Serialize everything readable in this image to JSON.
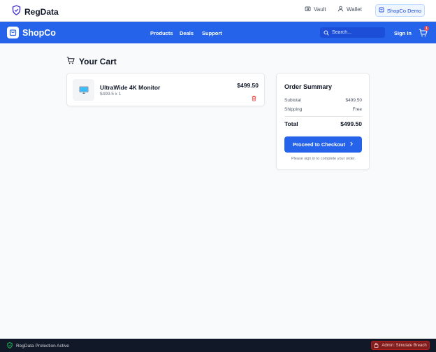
{
  "regdata": {
    "brand": "RegData",
    "nav": {
      "vault": "Vault",
      "wallet": "Wallet",
      "demo": "ShopCo Demo"
    }
  },
  "shop": {
    "brand": "ShopCo",
    "links": [
      "Products",
      "Deals",
      "Support"
    ],
    "search_placeholder": "Search...",
    "signin": "Sign In",
    "cart_count": "1",
    "brand_color": "#2563eb"
  },
  "cart": {
    "title": "Your Cart",
    "items": [
      {
        "name": "UltraWide 4K Monitor",
        "detail": "$499.5 x 1",
        "price": "$499.50",
        "icon": "monitor-icon"
      }
    ]
  },
  "summary": {
    "title": "Order Summary",
    "subtotal_label": "Subtotal",
    "subtotal_value": "$499.50",
    "shipping_label": "Shipping",
    "shipping_value": "Free",
    "total_label": "Total",
    "total_value": "$499.50",
    "checkout_label": "Proceed to Checkout",
    "note": "Please sign in to complete your order."
  },
  "footer": {
    "status": "RegData Protection Active",
    "admin_button": "Admin: Simulate Breach"
  }
}
